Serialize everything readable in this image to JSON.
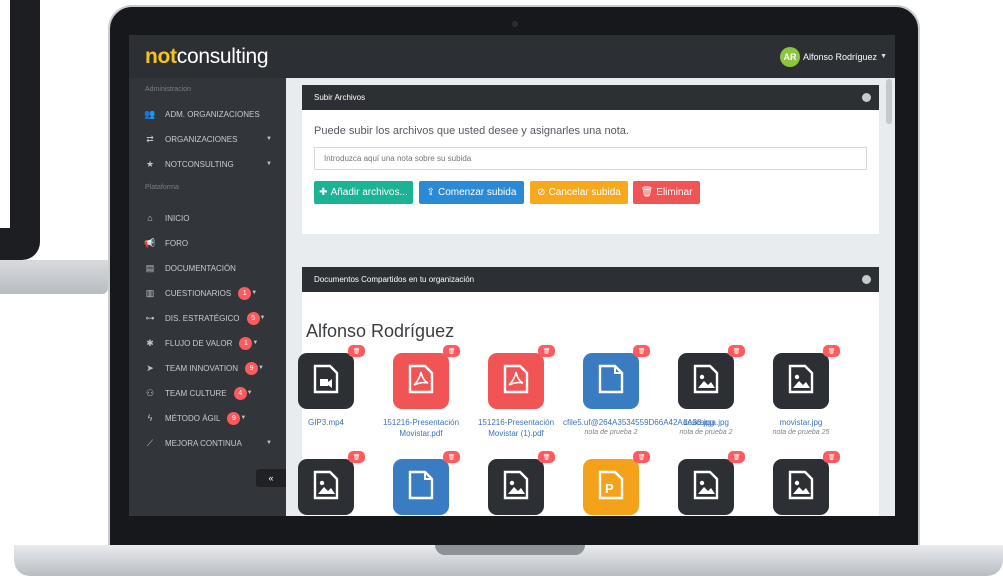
{
  "topbar": {
    "logo_bold": "not",
    "logo_rest": "consulting",
    "user_initials": "AR",
    "user_name": "Alfonso Rodríguez"
  },
  "sidebar": {
    "section_admin": "Administracion",
    "section_platform": "Plataforma",
    "collapse_label": "«",
    "items": [
      {
        "label": "ADM. ORGANIZACIONES",
        "icon": "users-icon",
        "glyph": "👥"
      },
      {
        "label": "ORGANIZACIONES",
        "icon": "exchange-icon",
        "glyph": "⇄"
      },
      {
        "label": "NOTCONSULTING",
        "icon": "star-icon",
        "glyph": "★"
      },
      {
        "label": "INICIO",
        "icon": "home-icon",
        "glyph": "⌂"
      },
      {
        "label": "FORO",
        "icon": "megaphone-icon",
        "glyph": "📢"
      },
      {
        "label": "DOCUMENTACIÓN",
        "icon": "file-icon",
        "glyph": "▤"
      },
      {
        "label": "CUESTIONARIOS",
        "icon": "bar-chart-icon",
        "glyph": "▥",
        "badge": "1"
      },
      {
        "label": "DIS. ESTRATÉGICO",
        "icon": "sitemap-icon",
        "glyph": "⊶",
        "badge": "5"
      },
      {
        "label": "FLUJO DE VALOR",
        "icon": "asterisk-icon",
        "glyph": "✱",
        "badge": "1"
      },
      {
        "label": "TEAM INNOVATION",
        "icon": "paper-plane-icon",
        "glyph": "➤",
        "badge": "9"
      },
      {
        "label": "TEAM CULTURE",
        "icon": "group-icon",
        "glyph": "⚇",
        "badge": "4"
      },
      {
        "label": "MÉTODO ÁGIL",
        "icon": "bolt-icon",
        "glyph": "ϟ",
        "badge": "9"
      },
      {
        "label": "MEJORA CONTINUA",
        "icon": "line-chart-icon",
        "glyph": "⟋"
      }
    ]
  },
  "upload": {
    "title": "Subir Archivos",
    "description": "Puede subir los archivos que usted desee y asignarles una nota.",
    "note_placeholder": "Introduzca aquí una nota sobre su subida",
    "btn_add": "Añadir archivos...",
    "btn_start": "Comenzar subida",
    "btn_cancel": "Cancelar subida",
    "btn_delete": "Eliminar"
  },
  "shared": {
    "title": "Documentos Compartidos en tu organización",
    "owner": "Alfonso Rodríguez",
    "files": [
      {
        "name": "GIP3.mp4",
        "note": "",
        "color": "#2c2f33",
        "icon": "video-file-icon"
      },
      {
        "name": "151216-Presentación Movistar.pdf",
        "note": "",
        "color": "#f05454",
        "icon": "pdf-file-icon"
      },
      {
        "name": "151216-Presentación Movistar (1).pdf",
        "note": "",
        "color": "#f05454",
        "icon": "pdf-file-icon"
      },
      {
        "name": "cfile5.uf@264A3534559D66A42A1A38.jpg",
        "note": "nota de prueba 2",
        "color": "#3a7cc1",
        "icon": "file-icon"
      },
      {
        "name": "descarga.jpg",
        "note": "nota de prueba 2",
        "color": "#2c2f33",
        "icon": "image-file-icon"
      },
      {
        "name": "movistar.jpg",
        "note": "nota de prueba 25",
        "color": "#2c2f33",
        "icon": "image-file-icon"
      },
      {
        "name": "",
        "note": "",
        "color": "#2c2f33",
        "icon": "image-file-icon"
      },
      {
        "name": "",
        "note": "",
        "color": "#3a7cc1",
        "icon": "file-icon"
      },
      {
        "name": "",
        "note": "",
        "color": "#2c2f33",
        "icon": "image-file-icon"
      },
      {
        "name": "",
        "note": "",
        "color": "#f5a21b",
        "icon": "powerpoint-file-icon"
      },
      {
        "name": "",
        "note": "",
        "color": "#2c2f33",
        "icon": "image-file-icon"
      },
      {
        "name": "",
        "note": "",
        "color": "#2c2f33",
        "icon": "image-file-icon"
      }
    ]
  },
  "colors": {
    "accent_yellow": "#f5c31a",
    "btn_add": "#1ab394",
    "btn_start": "#2a8ad6",
    "btn_cancel": "#f8a81b",
    "btn_delete": "#f05454",
    "badge": "#ff5a5f"
  }
}
